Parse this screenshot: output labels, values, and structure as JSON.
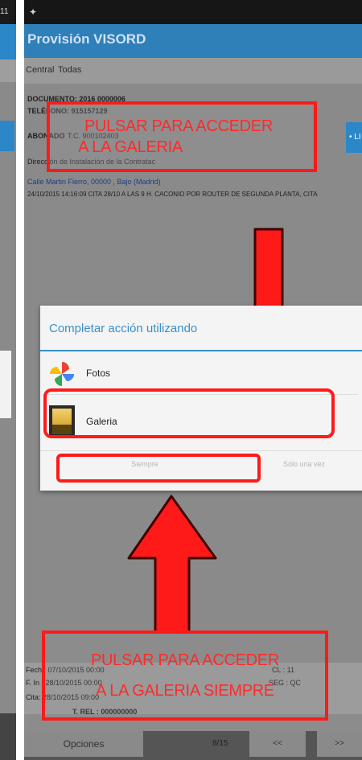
{
  "left_panel": {
    "status_time": "11"
  },
  "app": {
    "title": "Provisión VISORD"
  },
  "tabs": [
    "Central",
    "Todas"
  ],
  "content": {
    "documento": "DOCUMENTO: 2016 0000006",
    "telefono": "TELÉFONO: 915157129",
    "abonado_label": "ABONADO",
    "abonado_value": "T.C. 900102403",
    "direccion": "Dirección de Instalación de la Contratac",
    "address_link": "Calle Martin Fierro, 00000 , Bajo (Madrid)",
    "log_line": "24/10/2015 14:16:09 CITA 28/10 A LAS 9 H. CACONIO POR ROUTER DE SEGUNDA PLANTA, CITA",
    "right_button": "• LI"
  },
  "annotations": {
    "top": [
      "PULSAR PARA ACCEDER",
      "A LA GALERIA"
    ],
    "bottom": [
      "PULSAR PARA ACCEDER",
      "A LA GALERIA SIEMPRE"
    ]
  },
  "dialog": {
    "title": "Completar acción utilizando",
    "options": [
      {
        "label": "Fotos",
        "icon": "pinwheel-icon"
      },
      {
        "label": "Galeria",
        "icon": "gallery-icon"
      }
    ],
    "always_button": "Siempre",
    "once_button": "Sólo una vez"
  },
  "footer": {
    "fecha": "Fech : 07/10/2015 00:00",
    "cl": "CL : 11",
    "fin": "F. In : 28/10/2015 00:00",
    "seg": "SEG : QC",
    "cita": "Cita: 28/10/2015 09:00",
    "tel_ref": "T. REL : 000000000"
  },
  "nav": {
    "opciones": "Opciones",
    "page": "8/15",
    "prev": "<<",
    "next": ">>"
  },
  "colors": {
    "annotation_red": "#ff1a1a",
    "app_bar_blue": "#2f7fb8",
    "dialog_accent": "#3b8fc8"
  }
}
